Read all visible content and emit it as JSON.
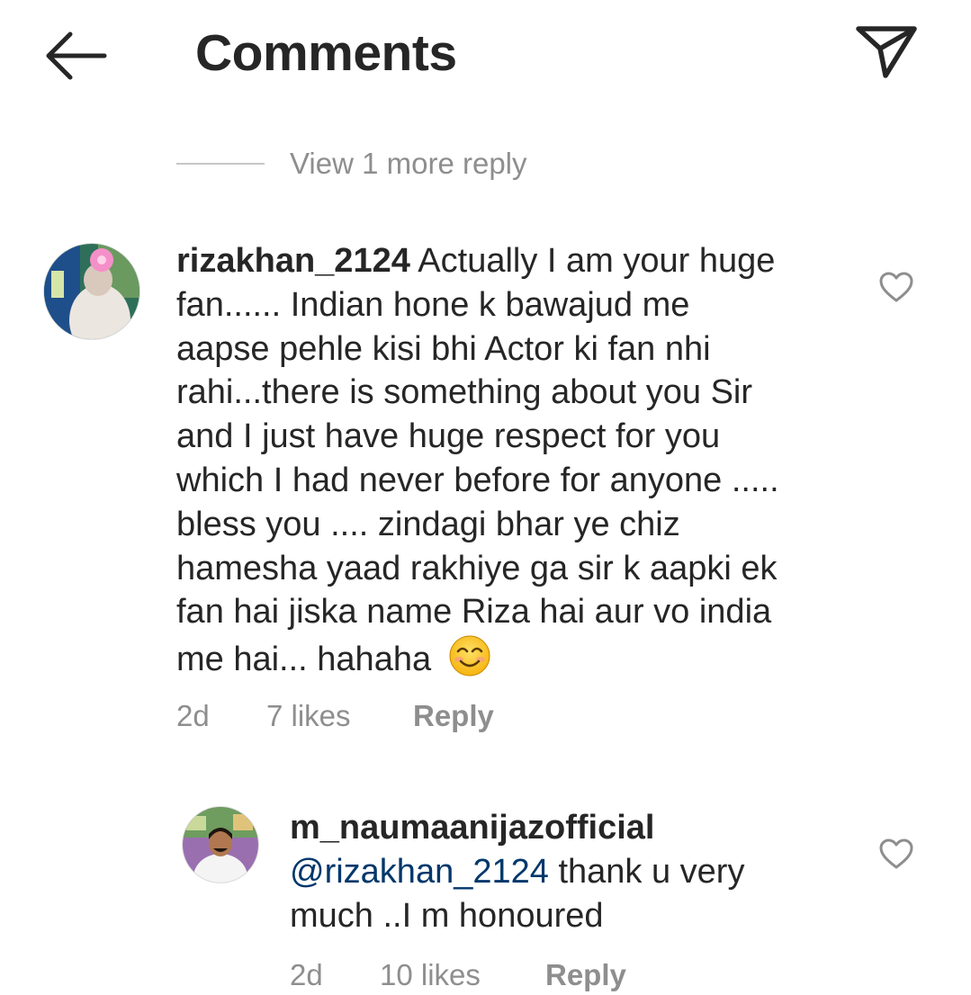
{
  "header": {
    "title": "Comments",
    "back_icon": "arrow-left-icon",
    "share_icon": "paper-plane-icon"
  },
  "view_more": {
    "label": "View 1 more reply"
  },
  "comments": [
    {
      "username": "rizakhan_2124",
      "text_lines": [
        " Actually I am your huge",
        "fan...... Indian hone k bawajud me",
        "aapse pehle kisi bhi Actor ki fan nhi",
        "rahi...there is something about you Sir",
        "and I just have huge respect for you",
        "which I had never before for anyone .....",
        "bless you .... zindagi bhar ye chiz",
        "hamesha yaad rakhiye ga sir k aapki ek",
        "fan hai jiska name Riza hai aur vo india",
        "me hai... hahaha "
      ],
      "emoji": "smiling-face-icon",
      "age": "2d",
      "likes": "7 likes",
      "reply_label": "Reply"
    },
    {
      "username": "m_naumaanijazofficial",
      "mention": "@rizakhan_2124",
      "text_lines": [
        " thank u very",
        "much ..I m honoured"
      ],
      "age": "2d",
      "likes": "10 likes",
      "reply_label": "Reply"
    }
  ],
  "colors": {
    "text": "#262626",
    "muted": "#8e8e8e",
    "mention": "#00376b",
    "divider": "#c7c7c7"
  }
}
